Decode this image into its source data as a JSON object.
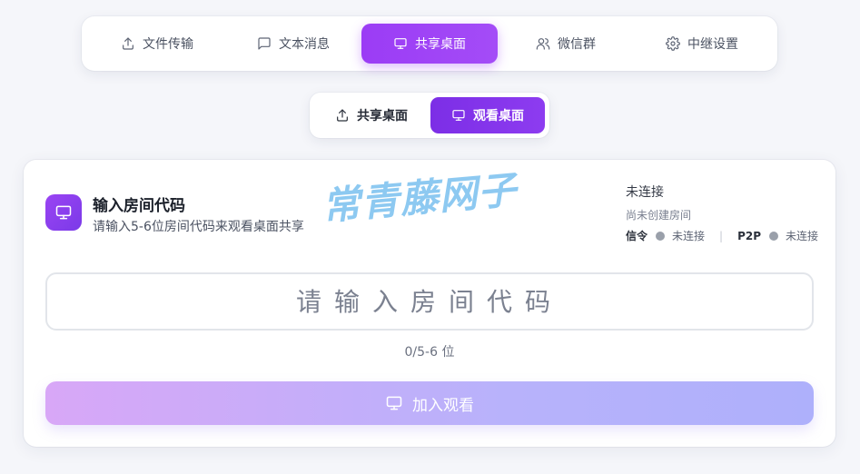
{
  "top_nav": {
    "items": [
      {
        "label": "文件传输",
        "icon": "upload-icon",
        "active": false
      },
      {
        "label": "文本消息",
        "icon": "message-icon",
        "active": false
      },
      {
        "label": "共享桌面",
        "icon": "monitor-icon",
        "active": true
      },
      {
        "label": "微信群",
        "icon": "users-icon",
        "active": false
      },
      {
        "label": "中继设置",
        "icon": "gear-icon",
        "active": false
      }
    ]
  },
  "sub_nav": {
    "items": [
      {
        "label": "共享桌面",
        "icon": "upload-icon",
        "active": false
      },
      {
        "label": "观看桌面",
        "icon": "monitor-icon",
        "active": true
      }
    ]
  },
  "card": {
    "icon": "monitor-icon",
    "title": "输入房间代码",
    "subtitle": "请输入5-6位房间代码来观看桌面共享",
    "status": {
      "title": "未连接",
      "room": "尚未创建房间",
      "signal_label": "信令",
      "signal_value": "未连接",
      "p2p_label": "P2P",
      "p2p_value": "未连接"
    },
    "input": {
      "value": "",
      "placeholder": "请输入房间代码"
    },
    "counter": "0/5-6 位",
    "join_button": "加入观看"
  },
  "watermark": "常青藤网子",
  "colors": {
    "accent": "#9b3cf5",
    "accent_dark": "#7c2ee6",
    "status_dot": "#9aa0aa",
    "button_gradient_start": "#d8a7f7",
    "button_gradient_end": "#aeb0fb"
  }
}
